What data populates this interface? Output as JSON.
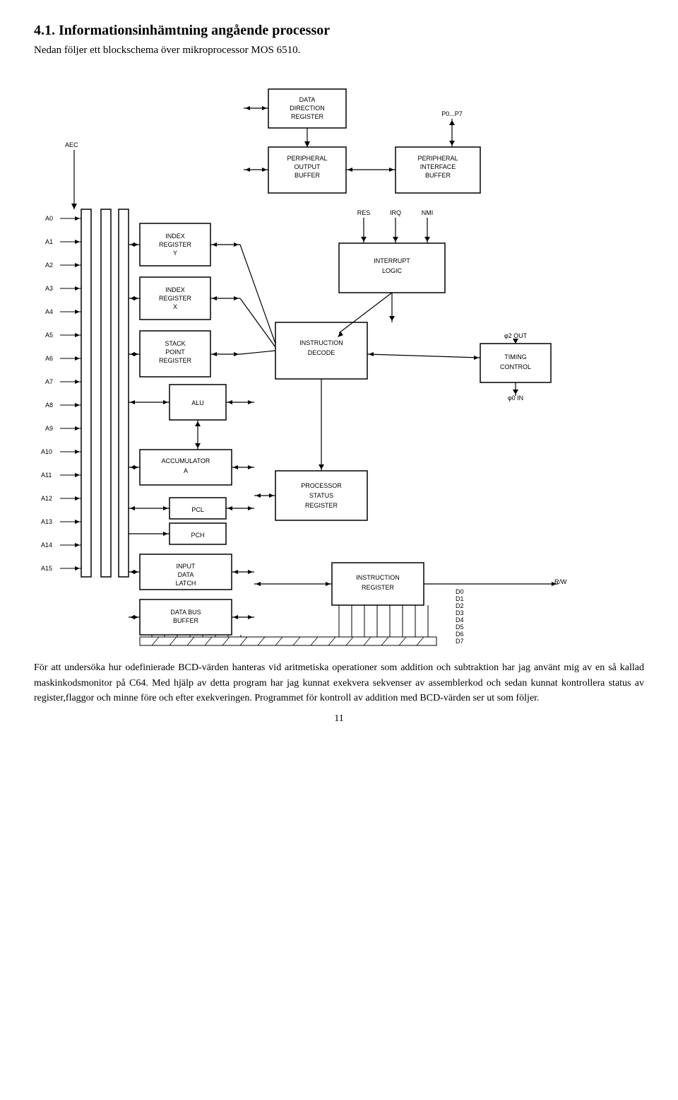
{
  "heading": "4.1. Informationsinhämtning angående processor",
  "intro": "Nedan följer ett blockschema över mikroprocessor MOS 6510.",
  "body1": "För att undersöka hur odefinierade BCD-värden hanteras vid aritmetiska operationer som addition och subtraktion har jag använt mig av en så kallad maskinkodsmonitor på C64. Med hjälp av detta program har jag kunnat exekvera sekvenser av assemblerkod och sedan kunnat kontrollera status av register,flaggor och minne före och efter exekveringen. Programmet för kontroll av addition med BCD-värden ser ut som följer.",
  "page_number": "11",
  "diagram": {
    "labels": {
      "data_direction_register": "DATA\nDIRECTION\nREGISTER",
      "peripheral_output_buffer": "PERIPHERAL\nOUTPUT\nBUFFER",
      "peripheral_interface_buffer": "PERIPHERAL\nINTERFACE\nBUFFER",
      "p0p7": "P0...P7",
      "aec": "AEC",
      "res": "RES",
      "irq": "IRQ",
      "nmi": "NMI",
      "index_register_y": "INDEX\nREGISTER\nY",
      "index_register_x": "INDEX\nREGISTER\nX",
      "stack_point_register": "STACK\nPOINT\nREGISTER",
      "alu": "ALU",
      "accumulator_a": "ACCUMULATOR\nA",
      "pcl": "PCL",
      "pch": "PCH",
      "input_data_latch": "INPUT\nDATA\nLATCH",
      "data_bus_buffer": "DATA BUS\nBUFFER",
      "interrupt_logic": "INTERRUPT\nLOGIC",
      "instruction_decode": "INSTRUCTION\nDECODE",
      "timing_control": "TIMING\nCONTROL",
      "processor_status_register": "PROCESSOR\nSTATUS\nREGISTER",
      "instruction_register": "INSTRUCTION\nREGISTER",
      "phi2_out": "φ2 OUT",
      "phi0_in": "φ0 IN",
      "rw": "R/W",
      "a0": "A0",
      "a1": "A1",
      "a2": "A2",
      "a3": "A3",
      "a4": "A4",
      "a5": "A5",
      "a6": "A6",
      "a7": "A7",
      "a8": "A8",
      "a9": "A9",
      "a10": "A10",
      "a11": "A11",
      "a12": "A12",
      "a13": "A13",
      "a14": "A14",
      "a15": "A15",
      "d0": "D0",
      "d1": "D1",
      "d2": "D2",
      "d3": "D3",
      "d4": "D4",
      "d5": "D5",
      "d6": "D6",
      "d7": "D7"
    }
  }
}
